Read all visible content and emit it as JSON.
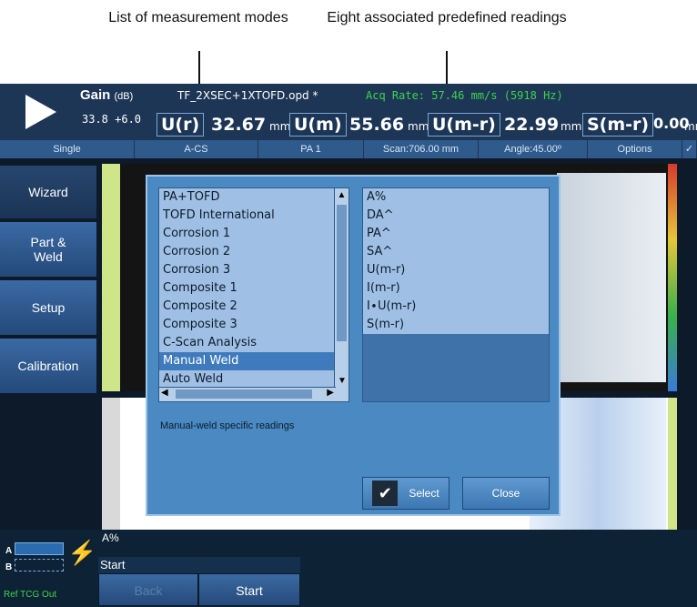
{
  "callouts": {
    "left": "List of measurement modes",
    "right": "Eight associated predefined readings"
  },
  "topbar": {
    "gain_label": "Gain",
    "gain_unit": "(dB)",
    "gain_value": "33.8 +6.0",
    "file_name": "TF_2XSEC+1XTOFD.opd *",
    "acq_rate": "Acq Rate: 57.46 mm/s (5918 Hz)",
    "readings": [
      {
        "label": "U(r)",
        "value": "32.67",
        "unit": "mm"
      },
      {
        "label": "U(m)",
        "value": "55.66",
        "unit": "mm"
      },
      {
        "label": "U(m-r)",
        "value": "22.99",
        "unit": "mm"
      },
      {
        "label": "S(m-r)",
        "value": "0.00",
        "unit": "mm"
      }
    ]
  },
  "strip": {
    "mode": "Single",
    "view": "A-CS",
    "group": "PA 1",
    "scan": "Scan:706.00 mm",
    "angle": "Angle:45.00º",
    "options": "Options"
  },
  "nav": {
    "wizard": "Wizard",
    "part_weld": "Part & Weld",
    "setup": "Setup",
    "calibration": "Calibration"
  },
  "dialog": {
    "modes": [
      "PA+TOFD",
      "TOFD International",
      "Corrosion 1",
      "Corrosion 2",
      "Corrosion 3",
      "Composite 1",
      "Composite 2",
      "Composite 3",
      "C-Scan Analysis",
      "Manual Weld",
      "Auto Weld"
    ],
    "selected_mode": "Manual Weld",
    "readings": [
      "A%",
      "DA^",
      "PA^",
      "SA^",
      "U(m-r)",
      "I(m-r)",
      "I∙U(m-r)",
      "S(m-r)"
    ],
    "description": "Manual-weld specific readings",
    "select_label": "Select",
    "close_label": "Close"
  },
  "bottom": {
    "section_label": "Start",
    "back_label": "Back",
    "start_label": "Start",
    "ref_label": "Ref TCG Out",
    "a_label": "A",
    "b_label": "B",
    "ascan_label": "A%"
  },
  "colors": {
    "dialog_bg": "#4a89c2",
    "list_bg": "#9fc0e4",
    "selected": "#3f7bbc",
    "topbar": "#1d3656"
  }
}
